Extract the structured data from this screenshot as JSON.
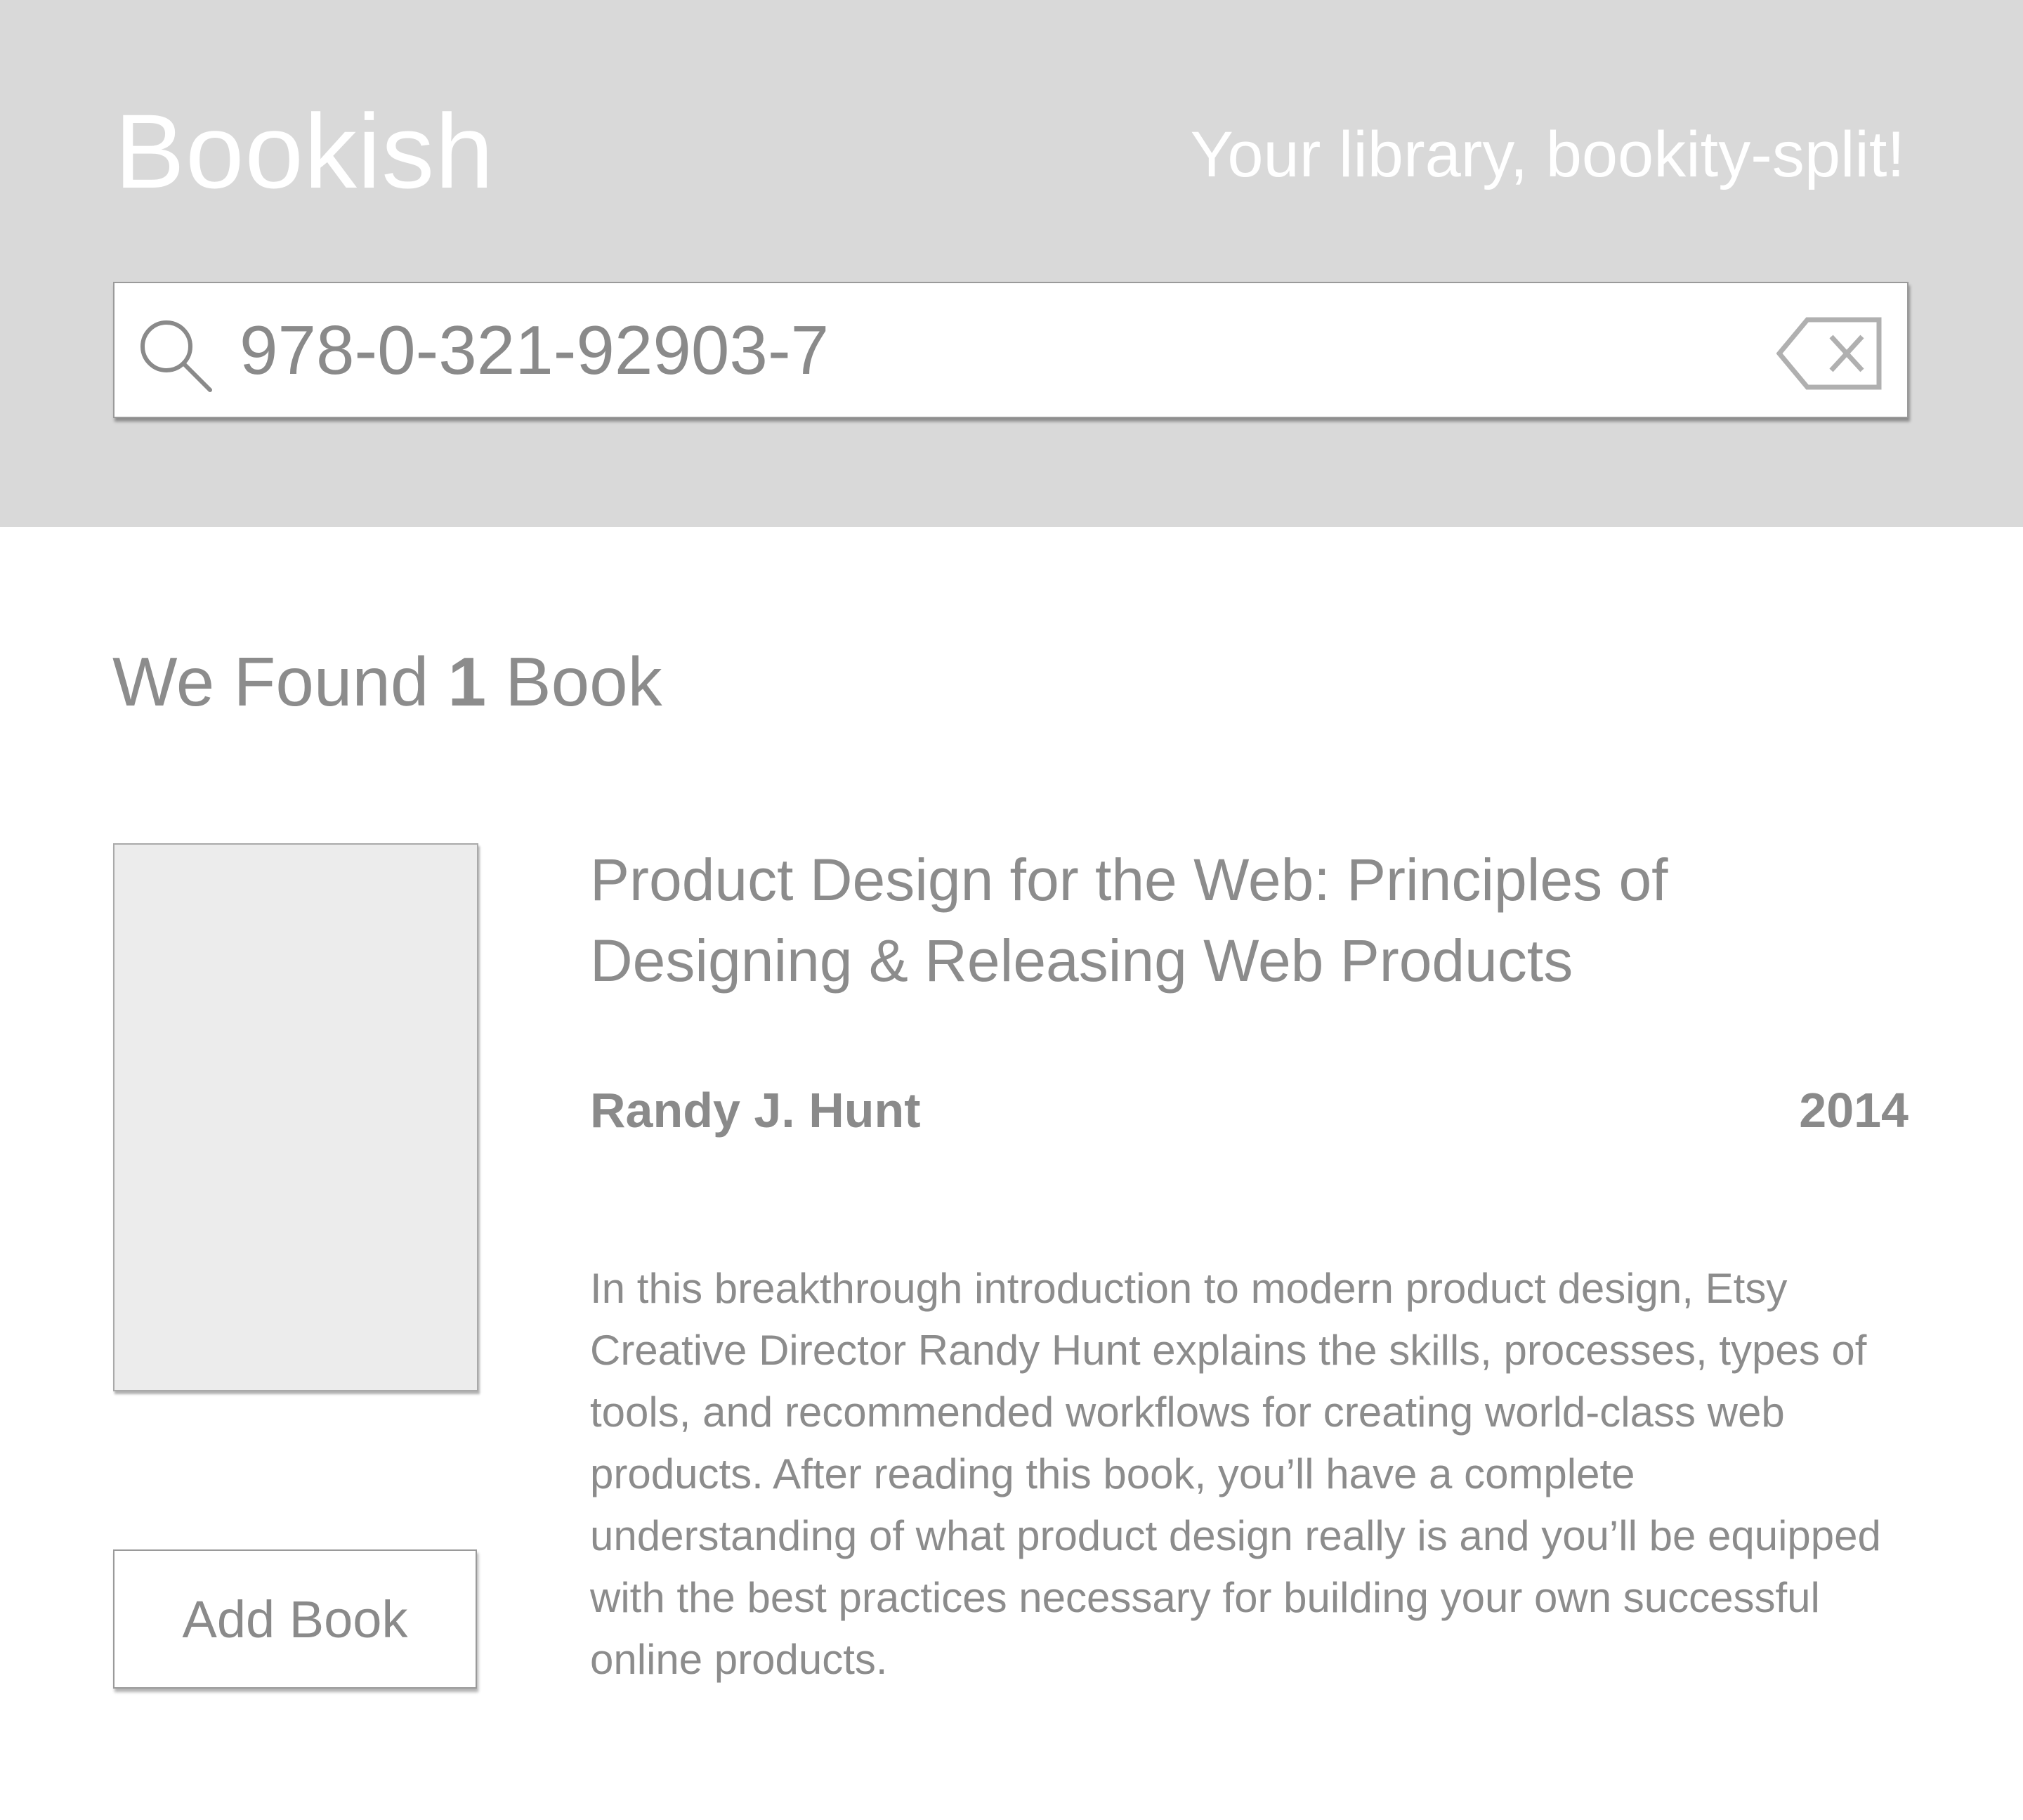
{
  "header": {
    "brand": "Bookish",
    "tagline": "Your library, bookity-split!"
  },
  "search": {
    "value": "978-0-321-92903-7",
    "search_icon": "search-icon",
    "clear_icon": "clear-backspace-icon"
  },
  "results": {
    "prefix": "We Found ",
    "count": "1",
    "suffix": " Book"
  },
  "book": {
    "title": "Product Design for the Web: Principles of Designing & Releasing Web Products",
    "author": "Randy J. Hunt",
    "year": "2014",
    "description": "In this breakthrough introduction to modern product design, Etsy Creative Director Randy Hunt explains the skills, processes, types of tools, and recommended workflows for creating world-class web products. After reading this book, you’ll have a complete understanding of what product design really is and you’ll be equipped with the best practices necessary for building your own successful online products."
  },
  "actions": {
    "add_book_label": "Add Book"
  },
  "colors": {
    "header_bg": "#d9d9d9",
    "text_gray": "#8c8c8c",
    "cover_placeholder": "#ececec"
  }
}
